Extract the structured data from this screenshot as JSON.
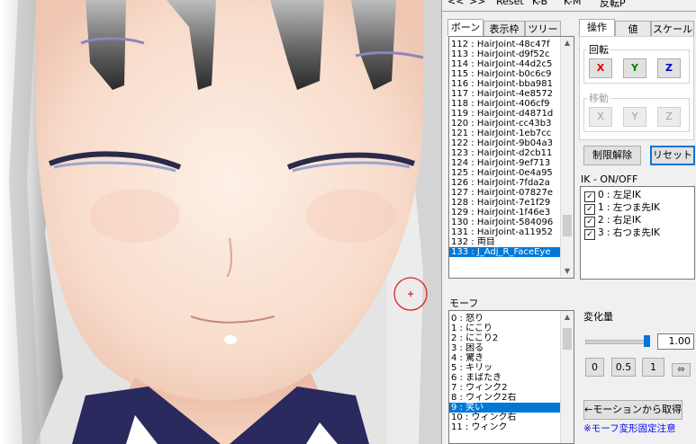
{
  "toolbar": {
    "prev_label": "<<",
    "next_label": ">>",
    "reset_label": "Reset",
    "kb_label": "K-B",
    "km_label": "K-M",
    "mirror_label": "反転P"
  },
  "bone_tabs": [
    "ボーン",
    "表示枠",
    "ツリー"
  ],
  "op_tabs": [
    "操作",
    "値",
    "スケール"
  ],
  "bone_list": {
    "items": [
      "112 : HairJoint-48c47f",
      "113 : HairJoint-d9f52c",
      "114 : HairJoint-44d2c5",
      "115 : HairJoint-b0c6c9",
      "116 : HairJoint-bba981",
      "117 : HairJoint-4e8572",
      "118 : HairJoint-406cf9",
      "119 : HairJoint-d4871d",
      "120 : HairJoint-cc43b3",
      "121 : HairJoint-1eb7cc",
      "122 : HairJoint-9b04a3",
      "123 : HairJoint-d2cb11",
      "124 : HairJoint-9ef713",
      "125 : HairJoint-0e4a95",
      "126 : HairJoint-7fda2a",
      "127 : HairJoint-07827e",
      "128 : HairJoint-7e1f29",
      "129 : HairJoint-1f46e3",
      "130 : HairJoint-584096",
      "131 : HairJoint-a11952",
      "132 : 両目",
      "133 : J_Adj_R_FaceEye"
    ],
    "selected_index": 21,
    "scroll_fraction": 0.85
  },
  "rotation": {
    "label": "回転",
    "x": "X",
    "y": "Y",
    "z": "Z"
  },
  "move": {
    "label": "移動",
    "x": "X",
    "y": "Y",
    "z": "Z"
  },
  "limit_release_label": "制限解除",
  "reset_button_label": "リセット",
  "ik": {
    "header": "IK - ON/OFF",
    "items": [
      {
        "label": "0 : 左足IK",
        "checked": true
      },
      {
        "label": "1 : 左つま先IK",
        "checked": true
      },
      {
        "label": "2 : 右足IK",
        "checked": true
      },
      {
        "label": "3 : 右つま先IK",
        "checked": true
      }
    ]
  },
  "morph": {
    "header": "モーフ",
    "items": [
      "0 : 怒り",
      "1 : にこり",
      "2 : にこり2",
      "3 : 困る",
      "4 : 驚き",
      "5 : キリッ",
      "6 : まばたき",
      "7 : ウィンク2",
      "8 : ウィンク2右",
      "9 : 笑い",
      "10 : ウィンク右",
      "11 : ウィンク"
    ],
    "selected_index": 9,
    "scroll_fraction": 0.05
  },
  "change": {
    "label": "変化量",
    "value": "1.00",
    "slider_fraction": 1.0,
    "preset_0": "0",
    "preset_05": "0.5",
    "preset_1": "1",
    "swap_symbol": "⬄"
  },
  "get_from_motion_label": "←モーションから取得",
  "morph_note": "※モーフ変形固定注意",
  "colors": {
    "x_axis": "#e00000",
    "y_axis": "#008000",
    "z_axis": "#0000c0",
    "selection": "#0078d7",
    "focus_border": "#0078d7",
    "note_text": "#0000ff",
    "gizmo": "#e02020"
  }
}
